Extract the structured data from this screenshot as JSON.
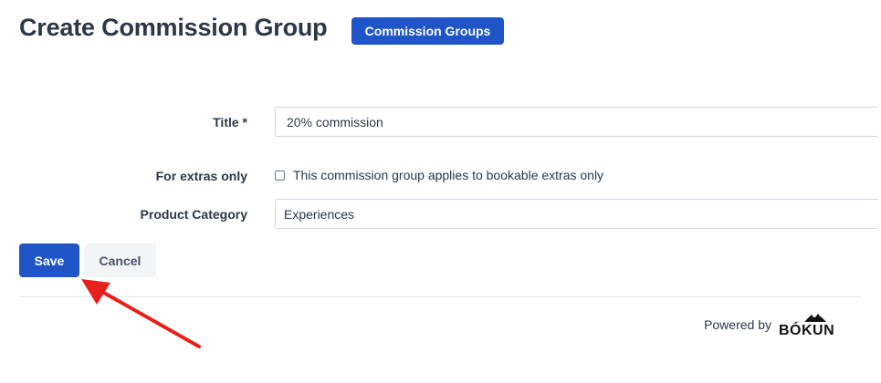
{
  "header": {
    "title": "Create Commission Group",
    "nav_button_label": "Commission Groups"
  },
  "form": {
    "title_field": {
      "label": "Title *",
      "value": "20% commission"
    },
    "extras_field": {
      "label": "For extras only",
      "checkbox_label": "This commission group applies to bookable extras only",
      "checked": false
    },
    "category_field": {
      "label": "Product Category",
      "selected_value": "Experiences"
    }
  },
  "actions": {
    "save_label": "Save",
    "cancel_label": "Cancel"
  },
  "footer": {
    "powered_by": "Powered by",
    "brand_logo_text": "BÓKUN"
  },
  "colors": {
    "primary": "#1f55c7",
    "annotation_arrow": "#e8201a"
  }
}
